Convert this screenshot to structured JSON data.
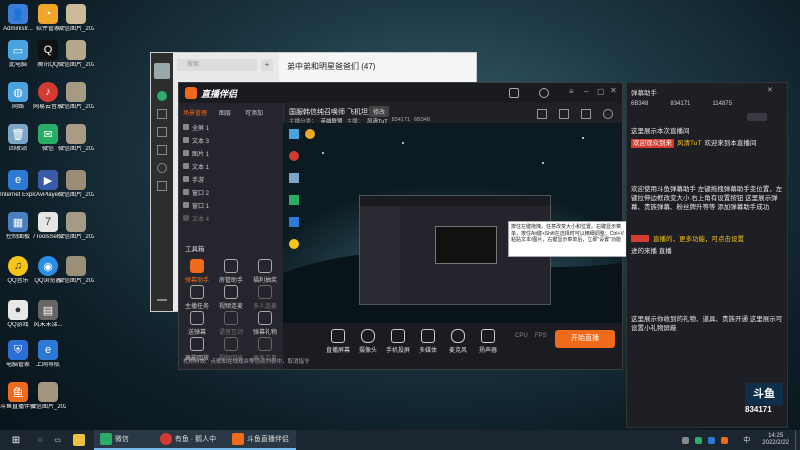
{
  "desktop_icons": [
    {
      "label": "Administr...",
      "color": "#3b7dd8"
    },
    {
      "label": "软件管家",
      "color": "#f0a52b"
    },
    {
      "label": "微信图片_2022012...",
      "color": "#ccb99a"
    },
    {
      "label": "此电脑",
      "color": "#4aa3df"
    },
    {
      "label": "腾讯QQ",
      "color": "#111111"
    },
    {
      "label": "微信图片_2022012...",
      "color": "#b7a88c"
    },
    {
      "label": "网络",
      "color": "#4aa3df"
    },
    {
      "label": "网易云音乐",
      "color": "#d33a31"
    },
    {
      "label": "微信图片_2022012...",
      "color": "#a79a82"
    },
    {
      "label": "回收站",
      "color": "#7ca6c8"
    },
    {
      "label": "微信",
      "color": "#2aae67"
    },
    {
      "label": "微信图片_2022012...",
      "color": "#a99b86"
    },
    {
      "label": "Internet Explorer",
      "color": "#2d7ad6"
    },
    {
      "label": "AvPlayer",
      "color": "#3a5aa8"
    },
    {
      "label": "微信图片_2022012...",
      "color": "#9a8c77"
    },
    {
      "label": "控制面板",
      "color": "#4a7fc1"
    },
    {
      "label": "7ToolsSet...",
      "color": "#e6e6e6"
    },
    {
      "label": "微信图片_2022012...",
      "color": "#a59a85"
    },
    {
      "label": "QQ音乐",
      "color": "#f5c518"
    },
    {
      "label": "QQ浏览器",
      "color": "#2a8de6"
    },
    {
      "label": "微信图片_2022012...",
      "color": "#9c8f7a"
    },
    {
      "label": "QQ游戏",
      "color": "#e8e8e8"
    },
    {
      "label": "风末未涕...",
      "color": "#666666"
    },
    {
      "label": "电脑管家",
      "color": "#2a6fd6"
    },
    {
      "label": "上网导航",
      "color": "#2d7ad6"
    },
    {
      "label": "斗鱼直播伴侣",
      "color": "#f06a1b"
    },
    {
      "label": "微信图片_2022012...",
      "color": "#a49781"
    }
  ],
  "chat_window": {
    "title": "弟中弟和明星爸爸们 (47)",
    "search_placeholder": "搜索",
    "add_button": "+"
  },
  "main_app": {
    "logo": "直播伴侣",
    "tabs": [
      "场景管理",
      "图层",
      "可添加"
    ],
    "stream_title": "国服韩信纯召唤师 飞机坦克",
    "edit_badge": "修改",
    "meta": [
      "主播分类：",
      "英雄联盟",
      "主播：",
      "风清TuT",
      "834171",
      "6B348"
    ],
    "layers": [
      "全屏 1",
      "文本 3",
      "图片 1",
      "文本 1",
      "手游",
      "窗口 2",
      "窗口 1",
      "文本 4"
    ],
    "tools_header": "工具箱",
    "tools": [
      {
        "label": "弹幕助手",
        "active": true
      },
      {
        "label": "房管助手"
      },
      {
        "label": "福利抽奖"
      },
      {
        "label": "主播任务"
      },
      {
        "label": "视频连麦"
      },
      {
        "label": "多人连麦"
      },
      {
        "label": "送弹幕"
      },
      {
        "label": "语音互动"
      },
      {
        "label": "弹幕礼物"
      },
      {
        "label": "高能回放"
      },
      {
        "label": "视频回放"
      },
      {
        "label": "更多工具"
      }
    ],
    "bottom_note": "礼物特效、点歌和在线观众等活动列表中，取消指令",
    "bottom_buttons": [
      "直播屏幕",
      "摄像头",
      "手机投屏",
      "多媒体",
      "麦克风",
      "扬声器"
    ],
    "fps_labels": [
      "CPU",
      "FPS"
    ],
    "start_live": "开始直播",
    "tooltip_text": "按住左键拖拽，任意改变大小和位置。右键显示菜单，按住Alt键+Shift在选择时可以精细调整；Ctrl+V粘贴文本/图片，右键显示菜单后，立即\"设置\"功能"
  },
  "right_panel": {
    "header": "弹幕助手",
    "stats": [
      "6B348",
      "834171",
      "114875"
    ],
    "welcome": "欢迎观众到来",
    "room_notice": "欢迎来到本直播间",
    "tip_title": "这里展示本次直播间",
    "user_tag": "风清TuT",
    "gift_hint": "直播的，更多功能，可点击设置",
    "help": "欢迎使用斗鱼弹幕助手 左键拖拽弹幕助手变位置，左键拉伸边框改变大小 右上角有设置按钮 这里展示弹幕、贵族弹幕、粉丝牌升等等 添加弹幕助手成功",
    "user_line": "进的来播 直播",
    "bottom_text": "这里展示你收到的礼物、道具、贵族开通 这里展示可设置小礼物屏蔽",
    "logo_small": "斗鱼 直播间",
    "logo_big_text": "斗鱼",
    "room_no": "834171"
  },
  "taskbar": {
    "items": [
      {
        "label": "微信",
        "color": "#2aae67"
      },
      {
        "label": "有鱼 · 鹅人中",
        "color": "#d33a31"
      },
      {
        "label": "斗鱼直播伴侣",
        "color": "#f06a1b"
      }
    ],
    "time": "14:25",
    "date": "2022/2/22",
    "input_method": "中"
  }
}
